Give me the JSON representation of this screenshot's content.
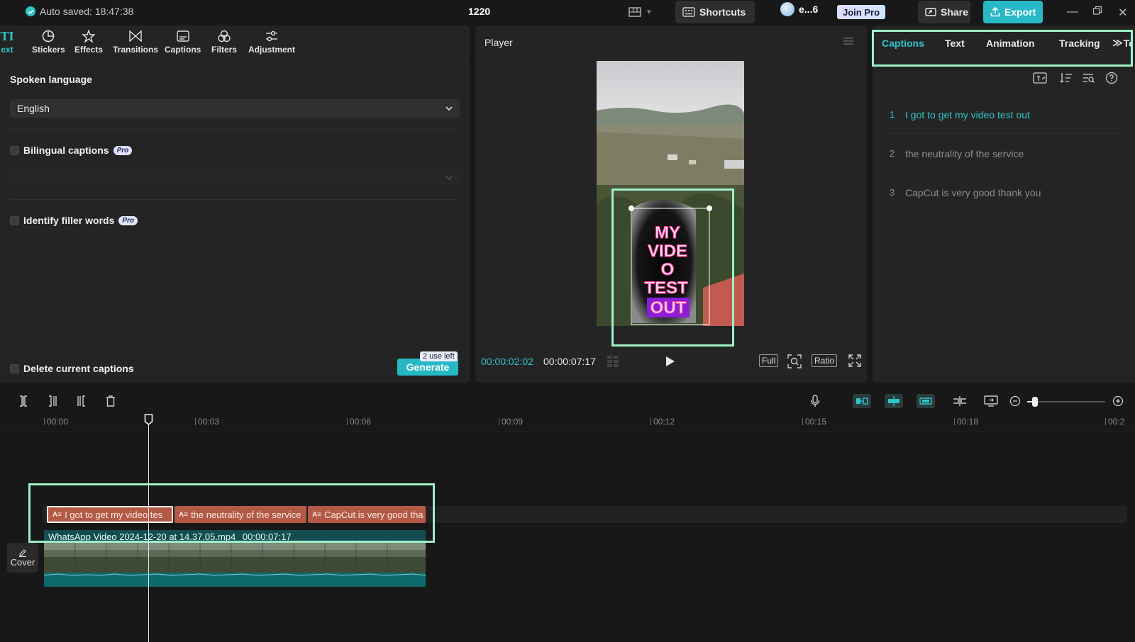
{
  "topbar": {
    "autosave": "Auto saved: 18:47:38",
    "project_title": "1220",
    "shortcuts_label": "Shortcuts",
    "account_name": "e...6",
    "join_pro_label": "Join Pro",
    "share_label": "Share",
    "export_label": "Export"
  },
  "toolbar": {
    "tools": [
      {
        "label": "ext",
        "icon": "text-icon",
        "active": true
      },
      {
        "label": "Stickers",
        "icon": "sticker-icon"
      },
      {
        "label": "Effects",
        "icon": "effects-icon"
      },
      {
        "label": "Transitions",
        "icon": "transitions-icon"
      },
      {
        "label": "Captions",
        "icon": "captions-icon"
      },
      {
        "label": "Filters",
        "icon": "filters-icon"
      },
      {
        "label": "Adjustment",
        "icon": "adjustment-icon"
      }
    ]
  },
  "captions_panel": {
    "spoken_language_label": "Spoken language",
    "spoken_language_value": "English",
    "bilingual_label": "Bilingual captions",
    "bilingual_badge": "Pro",
    "filler_label": "Identify filler words",
    "filler_badge": "Pro",
    "delete_label": "Delete current captions",
    "uses_left": "2 use left",
    "generate_label": "Generate"
  },
  "player": {
    "title": "Player",
    "caption_lines": [
      "MY",
      "VIDE",
      "O",
      "TEST"
    ],
    "caption_highlight": "OUT",
    "current_time": "00:00:02:02",
    "total_time": "00:00:07:17",
    "full_label": "Full",
    "ratio_label": "Ratio"
  },
  "right_panel": {
    "tabs": [
      "Captions",
      "Text",
      "Animation",
      "Tracking",
      "Te"
    ],
    "active_tab": "Captions",
    "captions": [
      {
        "num": "1",
        "text": "I got to get my video test out"
      },
      {
        "num": "2",
        "text": "the neutrality of the service"
      },
      {
        "num": "3",
        "text": "CapCut is very good thank you"
      }
    ]
  },
  "timeline": {
    "ticks": [
      "00:00",
      "00:03",
      "00:06",
      "00:09",
      "00:12",
      "00:15",
      "00:18",
      "00:2"
    ],
    "caption_clips": [
      {
        "text": "I got to get my video tes",
        "selected": true
      },
      {
        "text": "the neutrality of the service"
      },
      {
        "text": "CapCut is very good tha"
      }
    ],
    "clip_icon_text": "A≡",
    "video_clip_name": "WhatsApp Video 2024-12-20 at 14.37.05.mp4",
    "video_clip_duration": "00:00:07:17",
    "cover_label": "Cover",
    "zoom_level": 0.1
  },
  "colors": {
    "accent": "#2fc4c9",
    "highlight_box": "#9ff0c8",
    "caption_clip": "#b35a46",
    "video_clip": "#134d50"
  }
}
